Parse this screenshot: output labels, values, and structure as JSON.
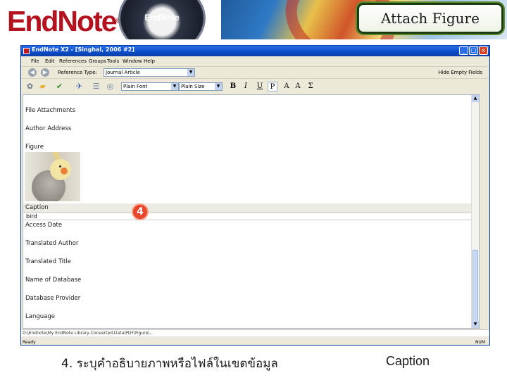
{
  "banner": {
    "logo": "EndNote",
    "logo_mark": "®",
    "orb_label": "EndNote",
    "title": "Attach Figure"
  },
  "window": {
    "title": "EndNote X2 - [Singhal, 2006 #2]",
    "buttons": {
      "minimize": "_",
      "maximize": "□",
      "close": "×"
    },
    "menu": [
      "File",
      "Edit",
      "References",
      "Groups",
      "Tools",
      "Window",
      "Help"
    ],
    "reference_type_label": "Reference Type:",
    "reference_type_value": "Journal Article",
    "hide_empty_fields": "Hide Empty Fields",
    "font_select": "Plain Font",
    "size_select": "Plain Size",
    "format_buttons": [
      "B",
      "I",
      "U",
      "P",
      "A",
      "A",
      "Σ"
    ]
  },
  "fields": [
    "File Attachments",
    "Author Address",
    "Figure",
    "Caption",
    "Access Date",
    "Translated Author",
    "Translated Title",
    "Name of Database",
    "Database Provider",
    "Language"
  ],
  "caption_value": "bird",
  "step_marker": "4",
  "path_bar": "D:\\Endnote\\My EndNote Library-Converted.Data\\PDF\\Figure\\...",
  "status": {
    "left": "Ready",
    "right": "NUM"
  },
  "footer": {
    "instruction": "4. ระบุคำอธิบายภาพหรือไฟล์ในเขตข้อมูล",
    "field_name": "Caption"
  },
  "colors": {
    "logo_red": "#b3121e",
    "titlebar_blue": "#0b3fa8",
    "marker_orange": "#e8472c"
  }
}
